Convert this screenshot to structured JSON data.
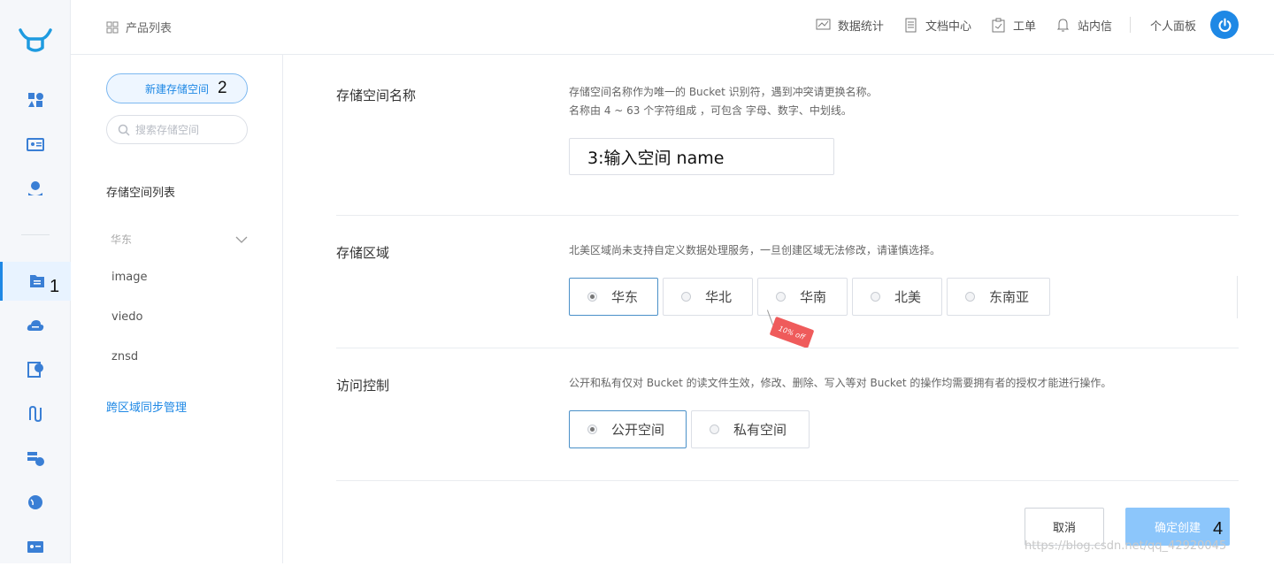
{
  "annotations": {
    "n1": "1",
    "n2": "2",
    "n4": "4"
  },
  "topbar": {
    "breadcrumb": "产品列表",
    "nav": [
      "数据统计",
      "文档中心",
      "工单",
      "站内信"
    ],
    "user": "个人面板"
  },
  "sidebar": {
    "new_button": "新建存储空间",
    "search_placeholder": "搜索存储空间",
    "list_title": "存储空间列表",
    "group": "华东",
    "items": [
      "image",
      "viedo",
      "znsd"
    ],
    "cross_region_link": "跨区域同步管理"
  },
  "form": {
    "name": {
      "label": "存储空间名称",
      "desc1": "存储空间名称作为唯一的 Bucket 识别符，遇到冲突请更换名称。",
      "desc2": "名称由 4 ~ 63 个字符组成 ，可包含 字母、数字、中划线。",
      "input_value": "3:输入空间 name"
    },
    "region": {
      "label": "存储区域",
      "desc": "北美区域尚未支持自定义数据处理服务，一旦创建区域无法修改，请谨慎选择。",
      "options": [
        "华东",
        "华北",
        "华南",
        "北美",
        "东南亚"
      ],
      "selected": "华东",
      "promo_tag": "10% off"
    },
    "access": {
      "label": "访问控制",
      "desc": "公开和私有仅对 Bucket 的读文件生效，修改、删除、写入等对 Bucket 的操作均需要拥有者的授权才能进行操作。",
      "options": [
        "公开空间",
        "私有空间"
      ],
      "selected": "公开空间"
    }
  },
  "actions": {
    "cancel": "取消",
    "confirm": "确定创建"
  },
  "watermark": "https://blog.csdn.net/qq_42920045",
  "colors": {
    "accent": "#1e88e5",
    "confirm_bg": "#8cc6fb",
    "promo": "#ef5b5b"
  }
}
